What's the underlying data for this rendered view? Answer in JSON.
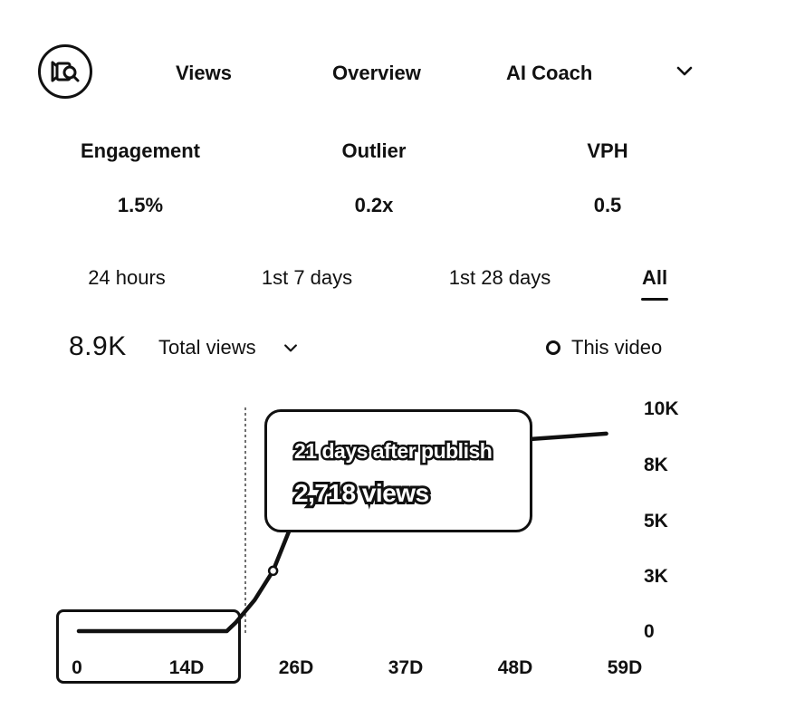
{
  "header": {
    "logo_icon": "video-magnifier-icon",
    "tabs": [
      "Views",
      "Overview",
      "AI Coach"
    ],
    "more_icon": "chevron-down-icon"
  },
  "stats": [
    {
      "label": "Engagement",
      "value": "1.5%"
    },
    {
      "label": "Outlier",
      "value": "0.2x"
    },
    {
      "label": "VPH",
      "value": "0.5"
    }
  ],
  "time_ranges": {
    "options": [
      "24 hours",
      "1st 7 days",
      "1st 28 days",
      "All"
    ],
    "selected": "All"
  },
  "summary": {
    "total": "8.9K",
    "metric": "Total views",
    "legend": "This video"
  },
  "tooltip": {
    "title": "21 days after publish",
    "value": "2,718 views"
  },
  "chart_data": {
    "type": "line",
    "title": "",
    "xlabel": "",
    "ylabel": "",
    "x_tick_labels": [
      "0",
      "14D",
      "26D",
      "37D",
      "48D",
      "59D"
    ],
    "x_tick_values": [
      0,
      14,
      26,
      37,
      48,
      59
    ],
    "y_tick_labels": [
      "0",
      "3K",
      "5K",
      "8K",
      "10K"
    ],
    "y_tick_values": [
      0,
      2500,
      5000,
      7500,
      10000
    ],
    "xlim": [
      0,
      59
    ],
    "ylim": [
      0,
      10000
    ],
    "series": [
      {
        "name": "This video",
        "x": [
          0,
          14,
          16,
          17,
          19,
          21,
          23,
          47,
          57
        ],
        "y": [
          0,
          0,
          0,
          400,
          1400,
          2718,
          4800,
          8600,
          8900
        ]
      }
    ],
    "highlight_x": 21,
    "grid": false,
    "legend": "top-right"
  }
}
